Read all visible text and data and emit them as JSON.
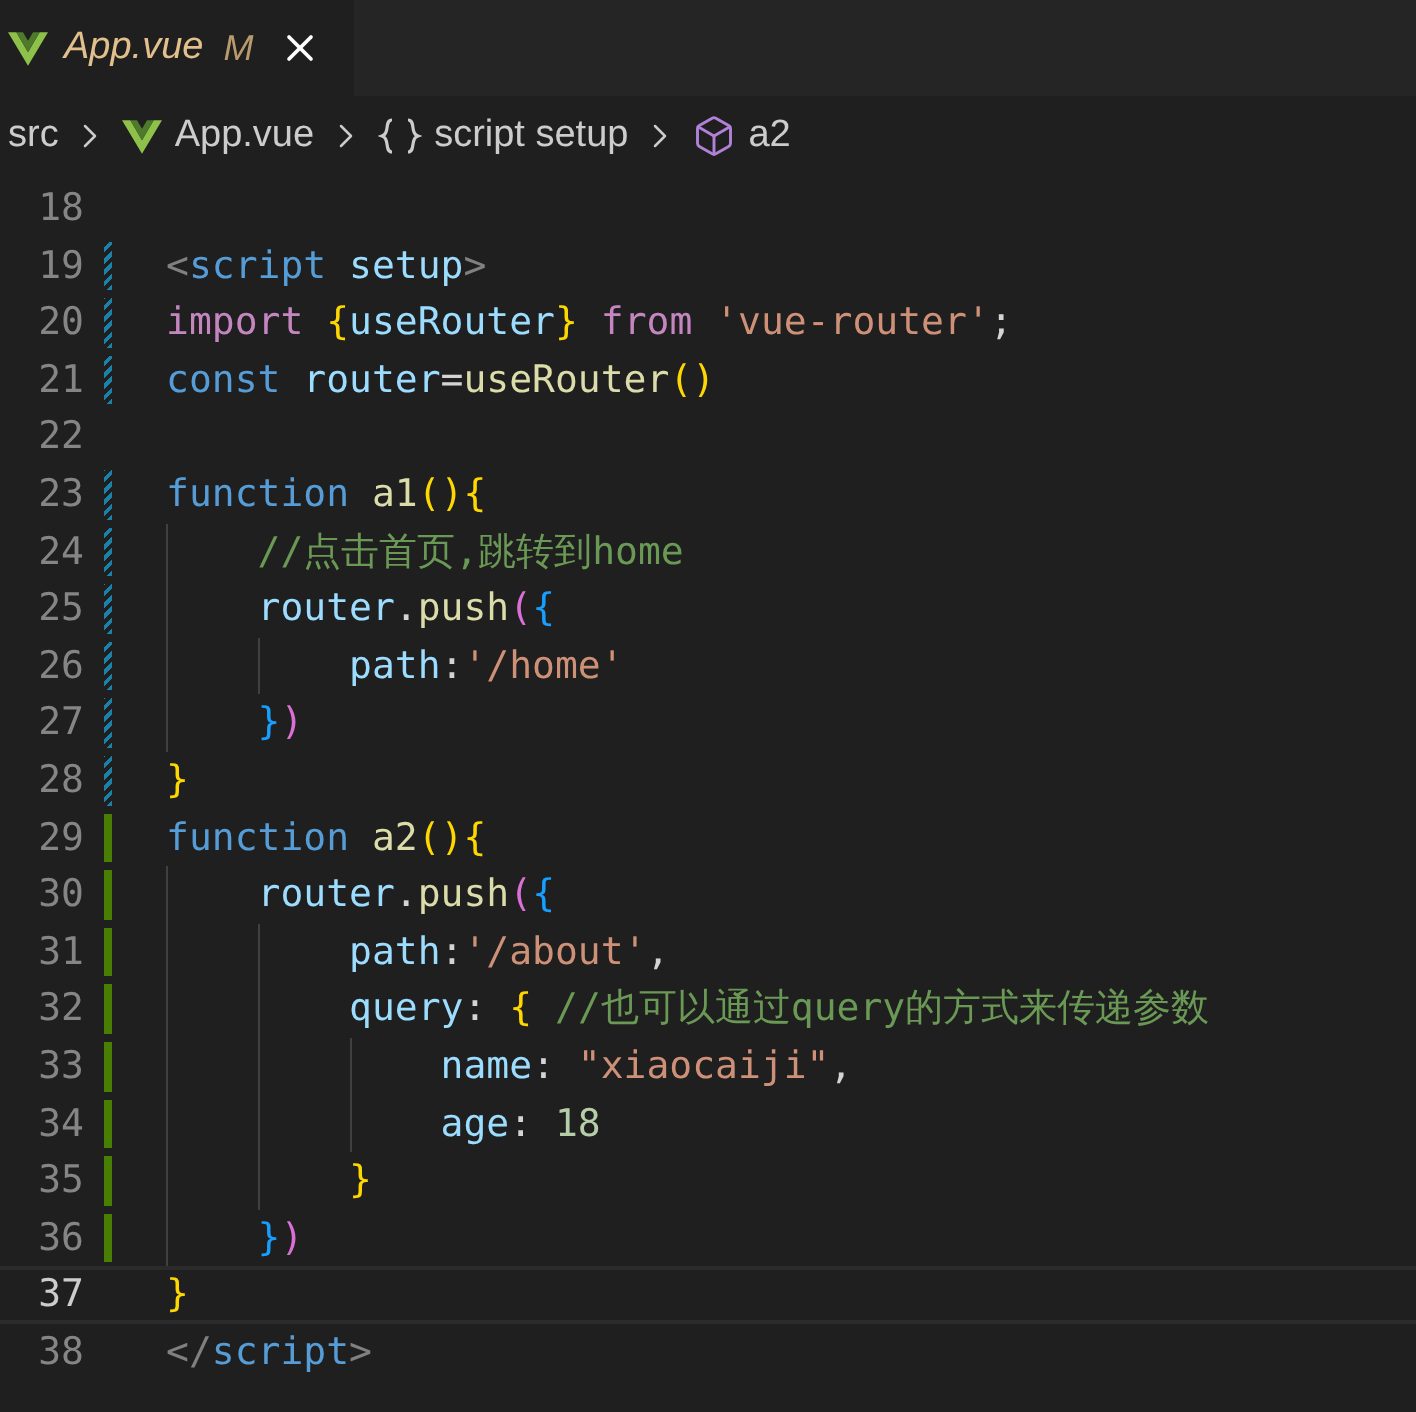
{
  "tab": {
    "label": "App.vue",
    "git_status": "M",
    "italic": true
  },
  "breadcrumbs": [
    {
      "kind": "folder",
      "label": "src"
    },
    {
      "kind": "file",
      "label": "App.vue"
    },
    {
      "kind": "scope",
      "label": "script setup"
    },
    {
      "kind": "symbol",
      "label": "a2"
    }
  ],
  "lines": [
    {
      "number": "18",
      "modified": false,
      "added": false,
      "current": false
    },
    {
      "number": "19",
      "modified": true,
      "added": false,
      "current": false,
      "tokens": [
        {
          "text": "<",
          "kind": "tagpunct"
        },
        {
          "text": "script",
          "kind": "tag"
        },
        {
          "text": " setup",
          "kind": "variable"
        },
        {
          "text": ">",
          "kind": "tagpunct"
        }
      ]
    },
    {
      "number": "20",
      "modified": true,
      "added": false,
      "current": false,
      "tokens": [
        {
          "text": "import ",
          "kind": "control"
        },
        {
          "text": "{",
          "kind": "bracket1"
        },
        {
          "text": "useRouter",
          "kind": "variable"
        },
        {
          "text": "}",
          "kind": "bracket1"
        },
        {
          "text": " from ",
          "kind": "control"
        },
        {
          "text": "'vue-router'",
          "kind": "string"
        },
        {
          "text": ";",
          "kind": "plain"
        }
      ]
    },
    {
      "number": "21",
      "modified": true,
      "added": false,
      "current": false,
      "tokens": [
        {
          "text": "const",
          "kind": "keyword"
        },
        {
          "text": " router",
          "kind": "variable"
        },
        {
          "text": "=",
          "kind": "plain"
        },
        {
          "text": "useRouter",
          "kind": "function"
        },
        {
          "text": "()",
          "kind": "bracket1"
        }
      ]
    },
    {
      "number": "22",
      "modified": false,
      "added": false,
      "current": false
    },
    {
      "number": "23",
      "modified": true,
      "added": false,
      "current": false,
      "tokens": [
        {
          "text": "function",
          "kind": "keyword"
        },
        {
          "text": " a1",
          "kind": "function"
        },
        {
          "text": "(){",
          "kind": "bracket1"
        }
      ]
    },
    {
      "number": "24",
      "modified": true,
      "added": false,
      "current": false,
      "tokens": [
        {
          "text": "    //点击首页,跳转到home",
          "kind": "comment"
        }
      ]
    },
    {
      "number": "25",
      "modified": true,
      "added": false,
      "current": false,
      "tokens": [
        {
          "text": "    router",
          "kind": "variable"
        },
        {
          "text": ".",
          "kind": "plain"
        },
        {
          "text": "push",
          "kind": "function"
        },
        {
          "text": "(",
          "kind": "bracket2"
        },
        {
          "text": "{",
          "kind": "bracket3"
        }
      ]
    },
    {
      "number": "26",
      "modified": true,
      "added": false,
      "current": false,
      "tokens": [
        {
          "text": "        path",
          "kind": "variable"
        },
        {
          "text": ":",
          "kind": "plain"
        },
        {
          "text": "'/home'",
          "kind": "string"
        }
      ]
    },
    {
      "number": "27",
      "modified": true,
      "added": false,
      "current": false,
      "tokens": [
        {
          "text": "    }",
          "kind": "bracket3"
        },
        {
          "text": ")",
          "kind": "bracket2"
        }
      ]
    },
    {
      "number": "28",
      "modified": true,
      "added": false,
      "current": false,
      "tokens": [
        {
          "text": "}",
          "kind": "bracket1"
        }
      ]
    },
    {
      "number": "29",
      "modified": false,
      "added": true,
      "current": false,
      "tokens": [
        {
          "text": "function",
          "kind": "keyword"
        },
        {
          "text": " a2",
          "kind": "function"
        },
        {
          "text": "(){",
          "kind": "bracket1"
        }
      ]
    },
    {
      "number": "30",
      "modified": false,
      "added": true,
      "current": false,
      "tokens": [
        {
          "text": "    router",
          "kind": "variable"
        },
        {
          "text": ".",
          "kind": "plain"
        },
        {
          "text": "push",
          "kind": "function"
        },
        {
          "text": "(",
          "kind": "bracket2"
        },
        {
          "text": "{",
          "kind": "bracket3"
        }
      ]
    },
    {
      "number": "31",
      "modified": false,
      "added": true,
      "current": false,
      "tokens": [
        {
          "text": "        path",
          "kind": "variable"
        },
        {
          "text": ":",
          "kind": "plain"
        },
        {
          "text": "'/about'",
          "kind": "string"
        },
        {
          "text": ",",
          "kind": "plain"
        }
      ]
    },
    {
      "number": "32",
      "modified": false,
      "added": true,
      "current": false,
      "tokens": [
        {
          "text": "        query",
          "kind": "variable"
        },
        {
          "text": ": ",
          "kind": "plain"
        },
        {
          "text": "{",
          "kind": "bracket1"
        },
        {
          "text": " //也可以通过query的方式来传递参数",
          "kind": "comment"
        }
      ]
    },
    {
      "number": "33",
      "modified": false,
      "added": true,
      "current": false,
      "tokens": [
        {
          "text": "            name",
          "kind": "variable"
        },
        {
          "text": ": ",
          "kind": "plain"
        },
        {
          "text": "\"xiaocaiji\"",
          "kind": "string"
        },
        {
          "text": ",",
          "kind": "plain"
        }
      ]
    },
    {
      "number": "34",
      "modified": false,
      "added": true,
      "current": false,
      "tokens": [
        {
          "text": "            age",
          "kind": "variable"
        },
        {
          "text": ": ",
          "kind": "plain"
        },
        {
          "text": "18",
          "kind": "number"
        }
      ]
    },
    {
      "number": "35",
      "modified": false,
      "added": true,
      "current": false,
      "tokens": [
        {
          "text": "        }",
          "kind": "bracket1"
        }
      ]
    },
    {
      "number": "36",
      "modified": false,
      "added": true,
      "current": false,
      "tokens": [
        {
          "text": "    }",
          "kind": "bracket3"
        },
        {
          "text": ")",
          "kind": "bracket2"
        }
      ]
    },
    {
      "number": "37",
      "modified": false,
      "added": false,
      "current": true,
      "tokens": [
        {
          "text": "}",
          "kind": "bracket1"
        }
      ]
    },
    {
      "number": "38",
      "modified": false,
      "added": false,
      "current": false,
      "tokens": [
        {
          "text": "</",
          "kind": "tagpunct"
        },
        {
          "text": "script",
          "kind": "tag"
        },
        {
          "text": ">",
          "kind": "tagpunct"
        }
      ]
    }
  ]
}
